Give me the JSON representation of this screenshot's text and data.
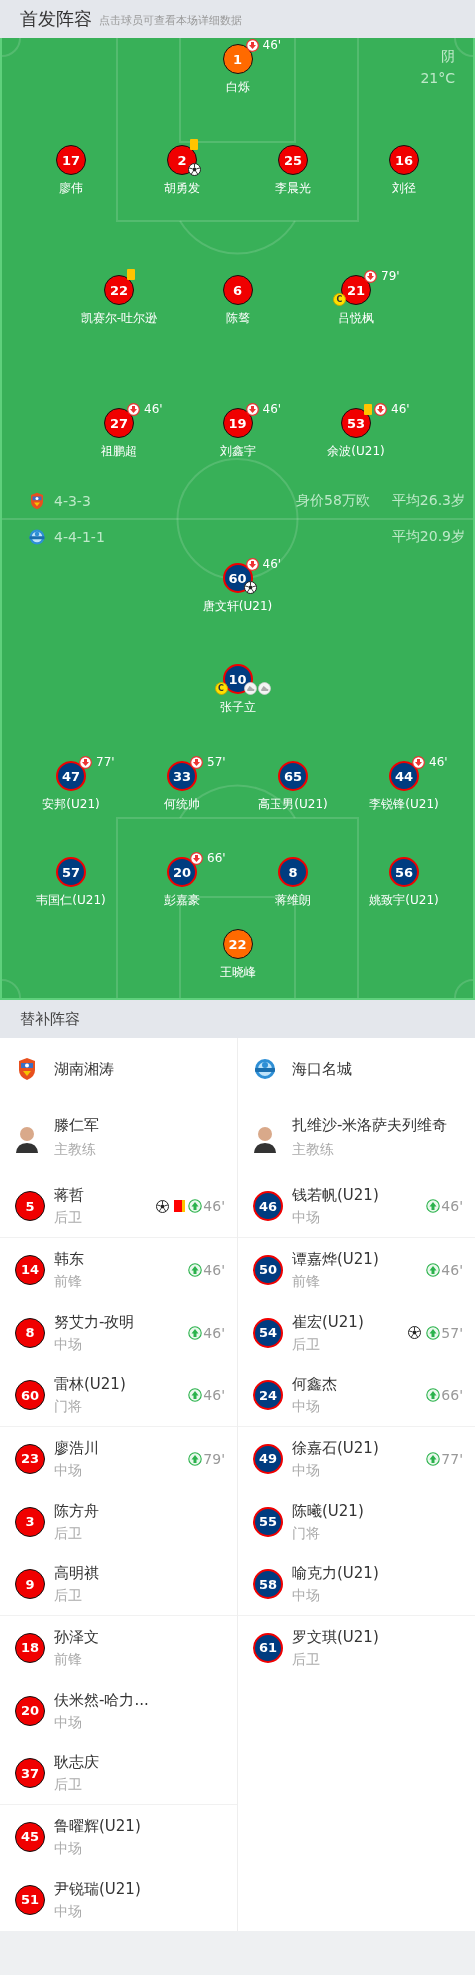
{
  "lineup": {
    "title": "首发阵容",
    "hint": "点击球员可查看本场详细数据",
    "weather": "阴",
    "temperature": "21°C",
    "teams": [
      {
        "formation": "4-3-3",
        "value": "身价58万欧",
        "average_age": "平均26.3岁",
        "rows": [
          {
            "players": [
              {
                "number": "1",
                "name": "白烁",
                "kind": "goalkeeper",
                "sub_out": "46'"
              }
            ]
          },
          {
            "players": [
              {
                "number": "17",
                "name": "廖伟",
                "kind": "outfield"
              },
              {
                "number": "2",
                "name": "胡勇发",
                "kind": "outfield",
                "yellow_card": true,
                "badges": [
                  {
                    "kind": "goal"
                  }
                ]
              },
              {
                "number": "25",
                "name": "李晨光",
                "kind": "outfield"
              },
              {
                "number": "16",
                "name": "刘径",
                "kind": "outfield"
              }
            ]
          },
          {
            "players": [
              {
                "number": "22",
                "name": "凯赛尔-吐尔逊",
                "kind": "outfield",
                "yellow_card": true
              },
              {
                "number": "6",
                "name": "陈骜",
                "kind": "outfield"
              },
              {
                "number": "21",
                "name": "吕悦枫",
                "kind": "outfield",
                "sub_out": "79'",
                "captain": "C"
              }
            ]
          },
          {
            "players": [
              {
                "number": "27",
                "name": "祖鹏超",
                "kind": "outfield",
                "sub_out": "46'"
              },
              {
                "number": "19",
                "name": "刘鑫宇",
                "kind": "outfield",
                "sub_out": "46'"
              },
              {
                "number": "53",
                "name": "余波(U21)",
                "kind": "outfield",
                "yellow_card": true,
                "sub_out": "46'"
              }
            ]
          }
        ]
      },
      {
        "formation": "4-4-1-1",
        "average_age": "平均20.9岁",
        "rows": [
          {
            "players": [
              {
                "number": "60",
                "name": "唐文轩(U21)",
                "kind": "outfield",
                "sub_out": "46'",
                "badges": [
                  {
                    "kind": "goal"
                  }
                ]
              }
            ]
          },
          {
            "players": [
              {
                "number": "10",
                "name": "张子立",
                "kind": "outfield",
                "captain": "C",
                "badges": [
                  {
                    "kind": "assist"
                  },
                  {
                    "kind": "assist"
                  }
                ]
              }
            ]
          },
          {
            "players": [
              {
                "number": "47",
                "name": "安邦(U21)",
                "kind": "outfield",
                "sub_out": "77'"
              },
              {
                "number": "33",
                "name": "何统帅",
                "kind": "outfield",
                "sub_out": "57'"
              },
              {
                "number": "65",
                "name": "高玉男(U21)",
                "kind": "outfield"
              },
              {
                "number": "44",
                "name": "李锐锋(U21)",
                "kind": "outfield",
                "sub_out": "46'"
              }
            ]
          },
          {
            "players": [
              {
                "number": "57",
                "name": "韦国仁(U21)",
                "kind": "outfield"
              },
              {
                "number": "20",
                "name": "彭嘉豪",
                "kind": "outfield",
                "sub_out": "66'"
              },
              {
                "number": "8",
                "name": "蒋维朗",
                "kind": "outfield"
              },
              {
                "number": "56",
                "name": "姚致宇(U21)",
                "kind": "outfield"
              }
            ]
          },
          {
            "players": [
              {
                "number": "22",
                "name": "王晓峰",
                "kind": "goalkeeper"
              }
            ]
          }
        ]
      }
    ]
  },
  "substitutes": {
    "title": "替补阵容",
    "teams": [
      {
        "name": "湖南湘涛",
        "coach": "滕仁军",
        "coach_role": "主教练",
        "players": [
          {
            "number": "5",
            "name": "蒋哲",
            "position": "后卫",
            "goal": true,
            "red_card": true,
            "sub_in": "46'"
          },
          {
            "number": "14",
            "name": "韩东",
            "position": "前锋",
            "sub_in": "46'"
          },
          {
            "number": "8",
            "name": "努艾力-孜明",
            "position": "中场",
            "sub_in": "46'"
          },
          {
            "number": "60",
            "name": "雷林(U21)",
            "position": "门将",
            "sub_in": "46'"
          },
          {
            "number": "23",
            "name": "廖浩川",
            "position": "中场",
            "sub_in": "79'"
          },
          {
            "number": "3",
            "name": "陈方舟",
            "position": "后卫"
          },
          {
            "number": "9",
            "name": "高明祺",
            "position": "后卫"
          },
          {
            "number": "18",
            "name": "孙泽文",
            "position": "前锋"
          },
          {
            "number": "20",
            "name": "伕米然-哈力...",
            "position": "中场"
          },
          {
            "number": "37",
            "name": "耿志庆",
            "position": "后卫"
          },
          {
            "number": "45",
            "name": "鲁曜辉(U21)",
            "position": "中场"
          },
          {
            "number": "51",
            "name": "尹锐瑞(U21)",
            "position": "中场"
          }
        ]
      },
      {
        "name": "海口名城",
        "coach": "扎维沙-米洛萨夫列维奇",
        "coach_role": "主教练",
        "players": [
          {
            "number": "46",
            "name": "钱若帆(U21)",
            "position": "中场",
            "sub_in": "46'"
          },
          {
            "number": "50",
            "name": "谭嘉烨(U21)",
            "position": "前锋",
            "sub_in": "46'"
          },
          {
            "number": "54",
            "name": "崔宏(U21)",
            "position": "后卫",
            "goal": true,
            "sub_in": "57'"
          },
          {
            "number": "24",
            "name": "何鑫杰",
            "position": "中场",
            "sub_in": "66'"
          },
          {
            "number": "49",
            "name": "徐嘉石(U21)",
            "position": "中场",
            "sub_in": "77'"
          },
          {
            "number": "55",
            "name": "陈曦(U21)",
            "position": "门将"
          },
          {
            "number": "58",
            "name": "喻克力(U21)",
            "position": "中场"
          },
          {
            "number": "61",
            "name": "罗文琪(U21)",
            "position": "后卫"
          }
        ]
      }
    ]
  }
}
